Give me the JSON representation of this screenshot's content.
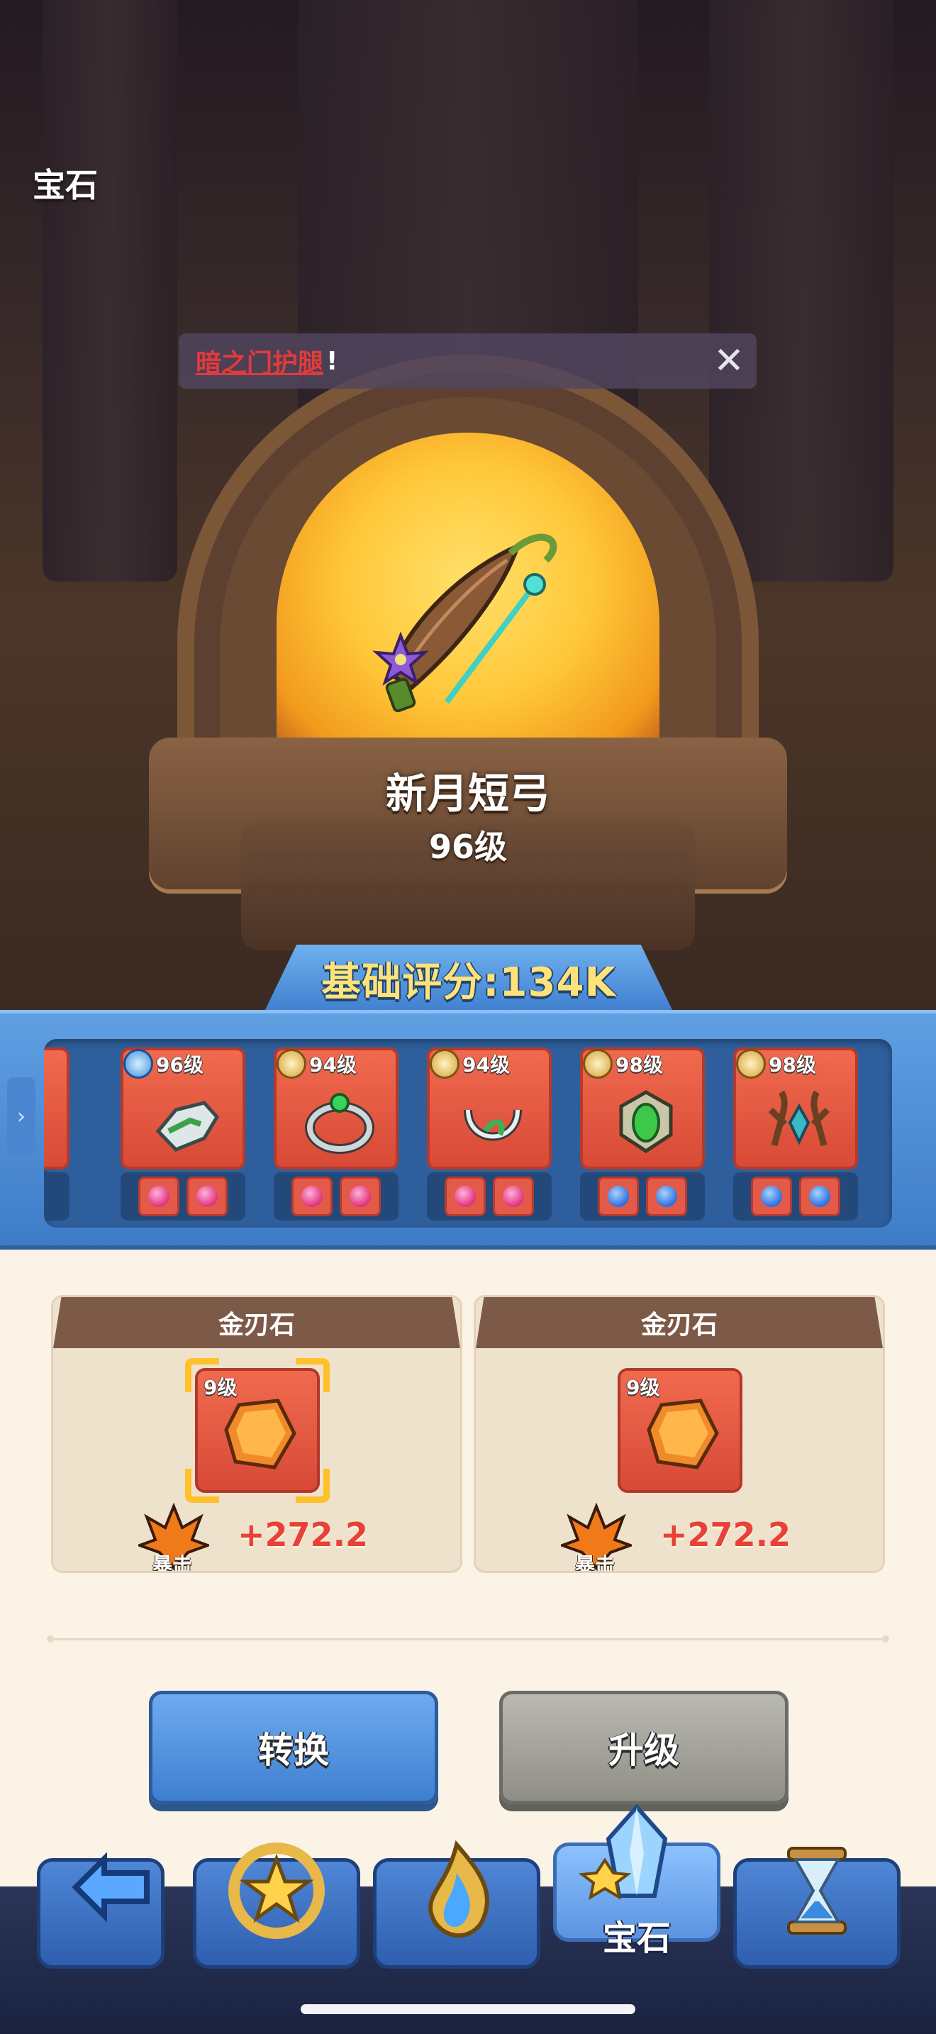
{
  "page": {
    "title": "宝石"
  },
  "notice": {
    "text": "暗之门护腿",
    "suffix": "!"
  },
  "weapon": {
    "name": "新月短弓",
    "level": "96级"
  },
  "score": {
    "text": "基础评分:134K"
  },
  "equipment": [
    {
      "level": "96级",
      "badge": "blue",
      "gems": [
        "pink",
        "pink"
      ],
      "icon": "gauntlet-icon"
    },
    {
      "level": "94级",
      "badge": "gold",
      "gems": [
        "pink",
        "pink"
      ],
      "icon": "ring-icon"
    },
    {
      "level": "94级",
      "badge": "gold",
      "gems": [
        "pink",
        "pink"
      ],
      "icon": "necklace-icon"
    },
    {
      "level": "98级",
      "badge": "gold",
      "gems": [
        "blue",
        "blue"
      ],
      "icon": "amulet-icon"
    },
    {
      "level": "98级",
      "badge": "gold",
      "gems": [
        "blue",
        "blue"
      ],
      "icon": "antler-crown-icon"
    }
  ],
  "gem_slots": [
    {
      "title": "金刃石",
      "level": "9级",
      "stat_label": "暴击",
      "stat_value": "+272.2",
      "selected": true
    },
    {
      "title": "金刃石",
      "level": "9级",
      "stat_label": "暴击",
      "stat_value": "+272.2",
      "selected": false
    }
  ],
  "buttons": {
    "convert": "转换",
    "upgrade": "升级"
  },
  "nav": {
    "tabs": [
      {
        "icon": "return-arrow-icon",
        "label": ""
      },
      {
        "icon": "star-ring-icon",
        "label": ""
      },
      {
        "icon": "blue-flame-icon",
        "label": ""
      },
      {
        "icon": "crystal-gem-icon",
        "label": "宝石",
        "active": true
      },
      {
        "icon": "hourglass-icon",
        "label": ""
      }
    ]
  },
  "colors": {
    "accent_blue": "#3f7fd0",
    "stat_red": "#e8413a",
    "selected_frame": "#ffc02a"
  }
}
